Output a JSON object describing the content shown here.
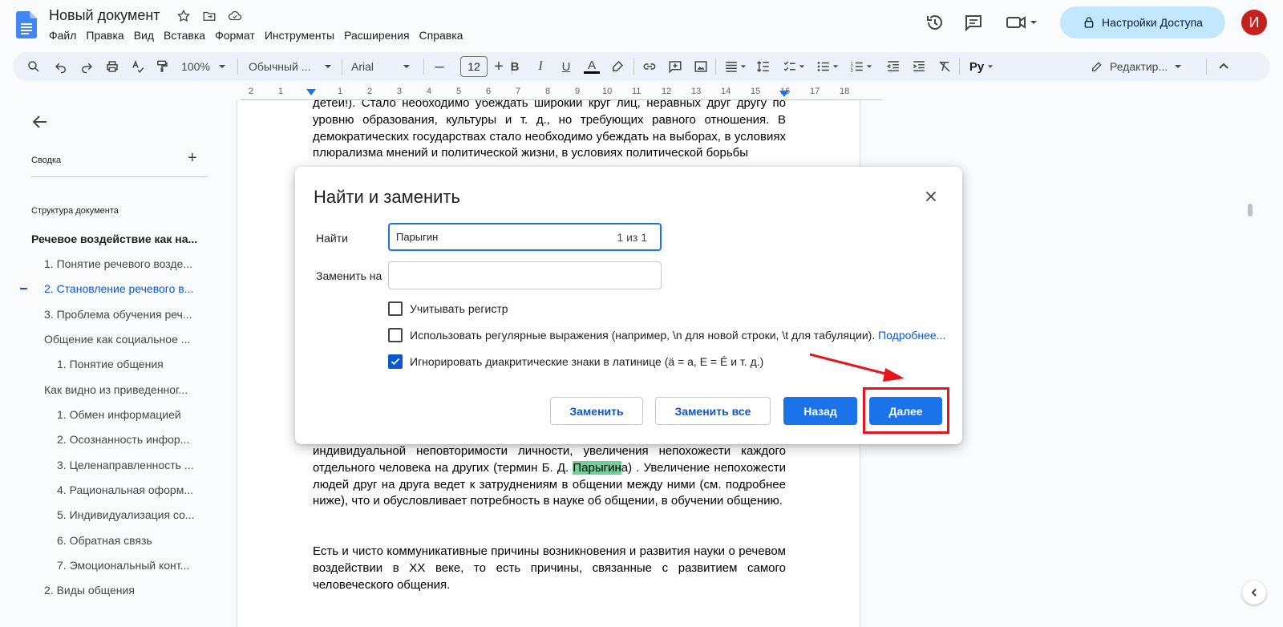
{
  "app": {
    "doc_title": "Новый документ",
    "menu": [
      "Файл",
      "Правка",
      "Вид",
      "Вставка",
      "Формат",
      "Инструменты",
      "Расширения",
      "Справка"
    ],
    "share_label": "Настройки Доступа",
    "avatar_letter": "И",
    "colors": {
      "accent": "#1a73e8",
      "share_bg": "#c2e7ff",
      "avatar_bg": "#c5221f",
      "highlight": "#6fcf97",
      "annotation": "#e8141b"
    }
  },
  "toolbar": {
    "zoom": "100%",
    "style": "Обычный ...",
    "font": "Arial",
    "font_size": "12",
    "mode": "Редактир..."
  },
  "ruler": {
    "numbers": [
      "2",
      "1",
      "1",
      "2",
      "3",
      "4",
      "5",
      "6",
      "7",
      "8",
      "9",
      "10",
      "11",
      "12",
      "13",
      "14",
      "15",
      "16",
      "17",
      "18"
    ]
  },
  "sidebar": {
    "summary_label": "Сводка",
    "outline_label": "Структура документа",
    "items": [
      {
        "label": "Речевое воздействие как на...",
        "level": 1
      },
      {
        "label": "1. Понятие речевого возде...",
        "level": 2
      },
      {
        "label": "2. Становление речевого в...",
        "level": 2,
        "active": true
      },
      {
        "label": "3. Проблема обучения реч...",
        "level": 2
      },
      {
        "label": "Общение как социальное ...",
        "level": 2
      },
      {
        "label": "1. Понятие общения",
        "level": 3
      },
      {
        "label": "Как видно из приведенног...",
        "level": 2
      },
      {
        "label": "1. Обмен информацией",
        "level": 3
      },
      {
        "label": "2. Осознанность инфор...",
        "level": 3
      },
      {
        "label": "3. Целенаправленность ...",
        "level": 3
      },
      {
        "label": "4. Рациональная оформ...",
        "level": 3
      },
      {
        "label": "5. Индивидуализация со...",
        "level": 3
      },
      {
        "label": "6. Обратная связь",
        "level": 3
      },
      {
        "label": "7. Эмоциональный конт...",
        "level": 3
      },
      {
        "label": "2. Виды общения",
        "level": 2
      }
    ]
  },
  "document": {
    "para_top": "детей!). Стало необходимо убеждать широкий круг лиц, неравных друг другу по уровню образования, культуры и т. д., но требующих равного отношения. В демократических государствах стало необходимо убеждать на выборах, в условиях плюрализма мнений и политической жизни, в условиях политической борьбы",
    "para_mid_before": "индивидуальной неповторимости личности, увеличения непохожести каждого отдельного человека на других (термин Б. Д. ",
    "para_mid_highlight": "Парыгин",
    "para_mid_after": "а) . Увеличение непохожести людей друг на друга ведет к затруднениям в общении между ними (см. подробнее ниже), что и обусловливает потребность в науке об общении, в обучении общению.",
    "para_last": "Есть и чисто коммуникативные причины возникновения и развития науки о речевом воздействии в XX веке, то есть причины, связанные с развитием самого человеческого общения."
  },
  "dialog": {
    "title": "Найти и заменить",
    "find_label": "Найти",
    "find_value": "Парыгин",
    "match_count": "1 из 1",
    "replace_label": "Заменить на",
    "replace_value": "",
    "options": [
      {
        "label": "Учитывать регистр",
        "checked": false
      },
      {
        "label": "Использовать регулярные выражения (например, \\n для новой строки, \\t для табуляции).",
        "link": "Подробнее...",
        "checked": false
      },
      {
        "label": "Игнорировать диакритические знаки в латинице (ä = a, E = É и т. д.)",
        "checked": true
      }
    ],
    "buttons": {
      "replace": "Заменить",
      "replace_all": "Заменить все",
      "prev": "Назад",
      "next": "Далее"
    }
  }
}
